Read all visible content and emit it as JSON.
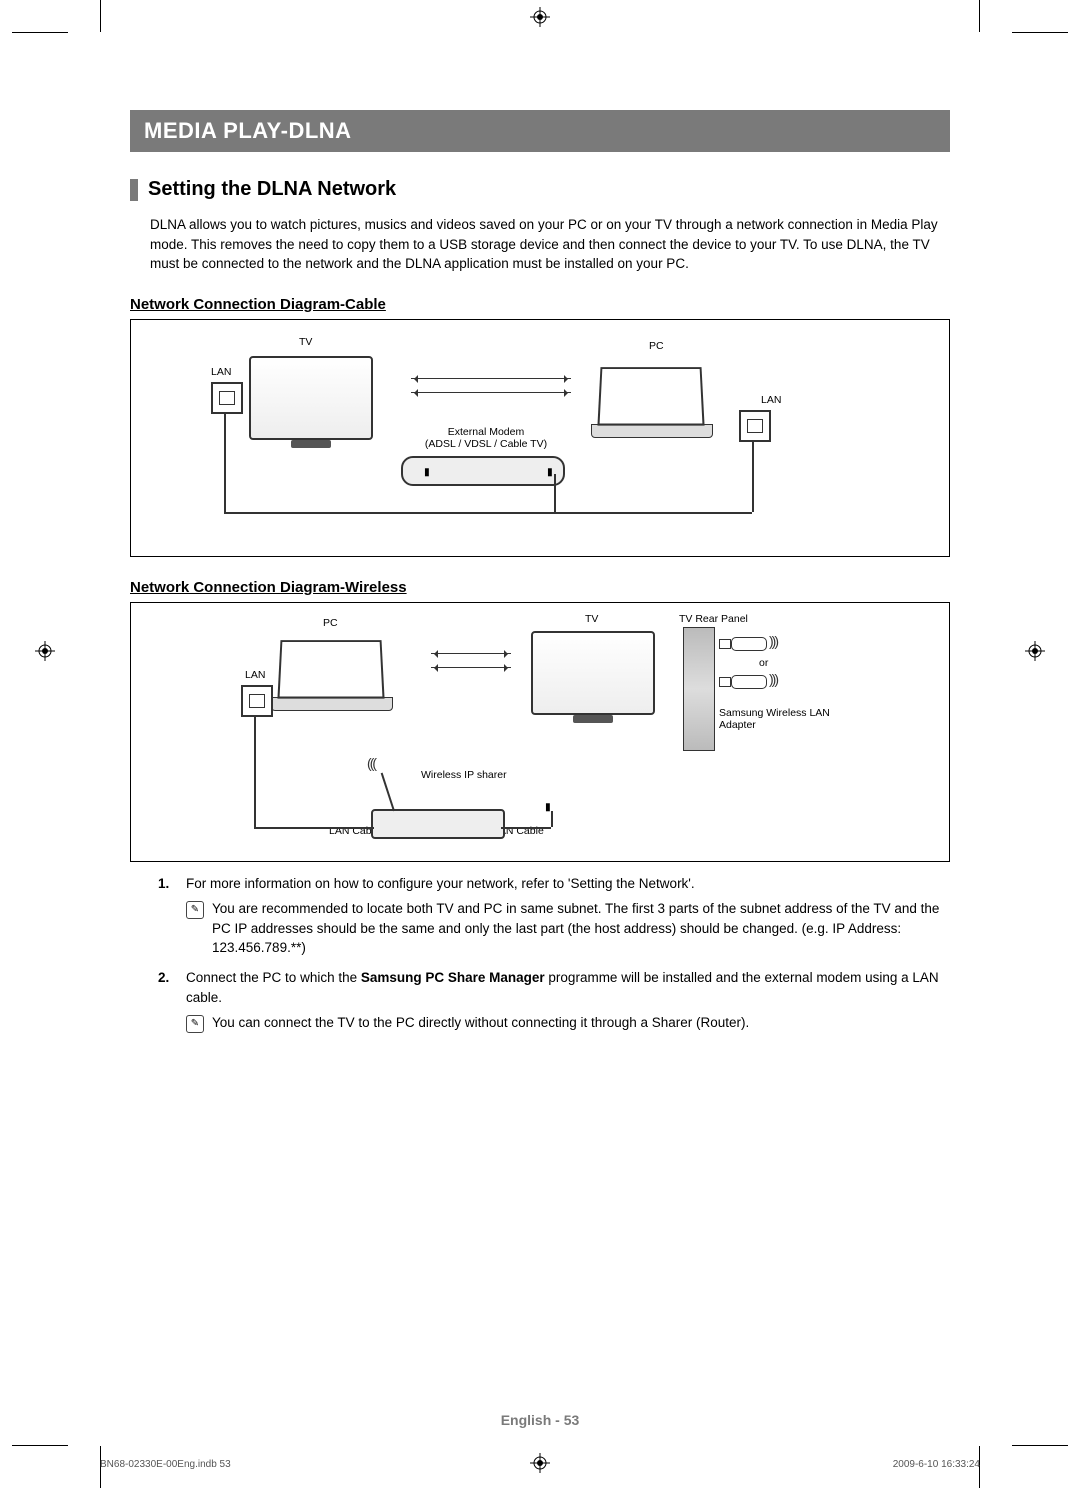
{
  "chapter_title": "MEDIA PLAY-DLNA",
  "section_title": "Setting the DLNA Network",
  "intro_text": "DLNA allows you to watch pictures, musics and videos saved on your PC or on your TV through a network connection in Media Play mode. This removes the need to copy them to a USB storage device and then connect the device to your TV. To use DLNA, the TV must be connected to the network and the DLNA application must be installed on your PC.",
  "diagram_cable": {
    "heading": "Network Connection Diagram-Cable",
    "labels": {
      "tv": "TV",
      "pc": "PC",
      "lan_left": "LAN",
      "lan_right": "LAN",
      "external_modem_line1": "External Modem",
      "external_modem_line2": "(ADSL / VDSL / Cable TV)"
    }
  },
  "diagram_wireless": {
    "heading": "Network Connection Diagram-Wireless",
    "labels": {
      "pc": "PC",
      "tv": "TV",
      "tv_rear_panel": "TV Rear Panel",
      "lan": "LAN",
      "wireless_ip_sharer": "Wireless IP sharer",
      "lan_cable_1": "LAN Cable",
      "lan_cable_2": "LAN Cable",
      "or": "or",
      "samsung_adapter_line1": "Samsung Wireless LAN",
      "samsung_adapter_line2": "Adapter"
    }
  },
  "steps": {
    "one": {
      "num": "1.",
      "text": "For more information on how to configure your network, refer to 'Setting the Network'.",
      "note": "You are recommended to locate both TV and PC in same subnet. The first 3 parts of the subnet address of the TV and the PC IP addresses should be the same and only the last part (the host address) should be changed. (e.g. IP Address: 123.456.789.**)"
    },
    "two": {
      "num": "2.",
      "text_before": "Connect the PC to which the ",
      "text_bold": "Samsung PC Share Manager",
      "text_after": " programme will be installed and the external modem using a LAN cable.",
      "note": "You can connect the TV to the PC directly without connecting it through a Sharer (Router)."
    }
  },
  "footer": "English - 53",
  "print_info_left": "BN68-02330E-00Eng.indb   53",
  "print_info_right": "2009-6-10   16:33:24"
}
